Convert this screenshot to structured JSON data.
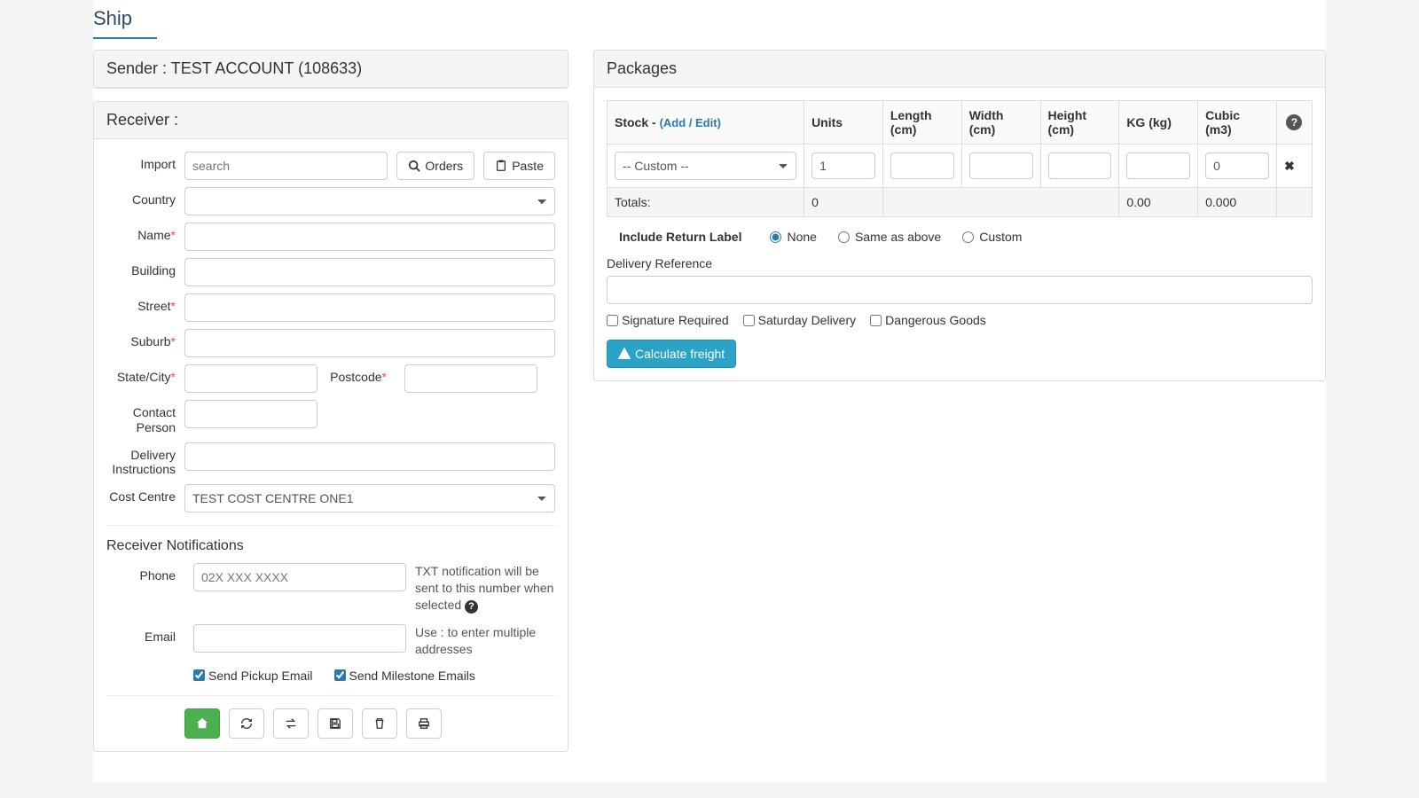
{
  "page": {
    "title": "Ship"
  },
  "sender": {
    "panel_title": "Sender : TEST ACCOUNT (108633)"
  },
  "receiver": {
    "panel_title": "Receiver :",
    "labels": {
      "import": "Import",
      "country": "Country",
      "name": "Name",
      "building": "Building",
      "street": "Street",
      "suburb": "Suburb",
      "statecity": "State/City",
      "postcode": "Postcode",
      "contact": "Contact Person",
      "delivery_instructions": "Delivery Instructions",
      "cost_centre": "Cost Centre"
    },
    "search_placeholder": "search",
    "orders_btn": "Orders",
    "paste_btn": "Paste",
    "cost_centre_value": "TEST COST CENTRE ONE1"
  },
  "notifications": {
    "heading": "Receiver Notifications",
    "phone_label": "Phone",
    "phone_placeholder": "02X XXX XXXX",
    "phone_note": "TXT notification will be sent to this number when selected",
    "email_label": "Email",
    "email_note": "Use : to enter multiple addresses",
    "send_pickup": "Send Pickup Email",
    "send_milestone": "Send Milestone Emails"
  },
  "packages": {
    "panel_title": "Packages",
    "headers": {
      "stock": "Stock - ",
      "stock_link": "(Add / Edit)",
      "units": "Units",
      "length": "Length (cm)",
      "width": "Width (cm)",
      "height": "Height (cm)",
      "kg": "KG (kg)",
      "cubic": "Cubic (m3)"
    },
    "row": {
      "stock_value": "-- Custom --",
      "units_value": "1",
      "cubic_value": "0"
    },
    "totals": {
      "label": "Totals:",
      "units": "0",
      "kg": "0.00",
      "cubic": "0.000"
    },
    "return_label": {
      "title": "Include Return Label",
      "none": "None",
      "same": "Same as above",
      "custom": "Custom"
    },
    "delivery_ref_label": "Delivery Reference",
    "sig_required": "Signature Required",
    "sat_delivery": "Saturday Delivery",
    "dangerous": "Dangerous Goods",
    "calc_btn": "Calculate freight"
  }
}
